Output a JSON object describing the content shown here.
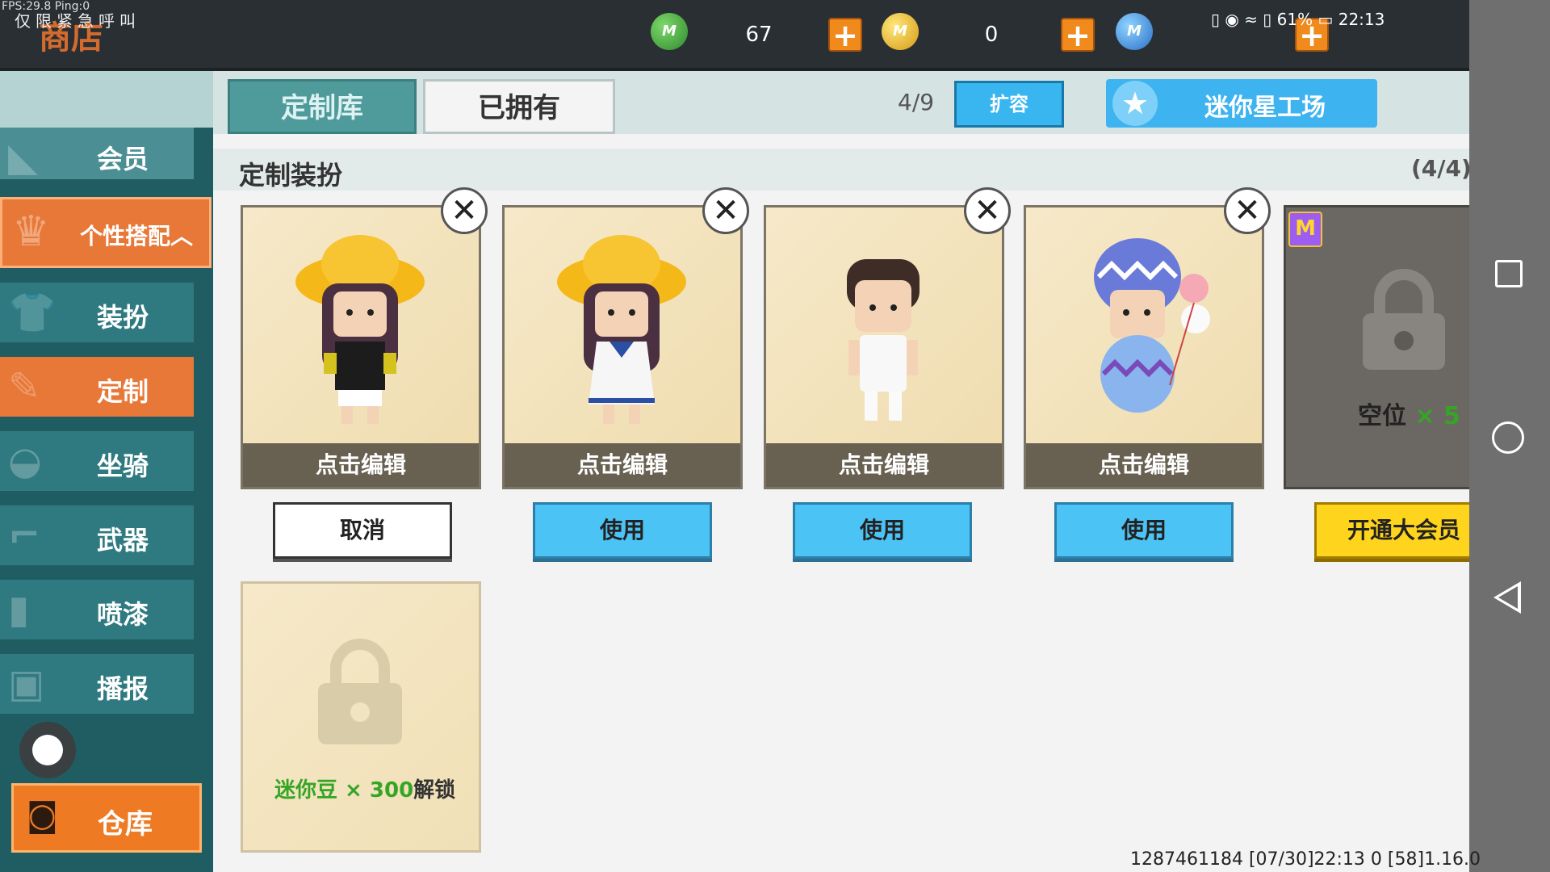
{
  "top": {
    "fps": "FPS:29.8  Ping:0",
    "status_strip": "仅限紧急呼叫",
    "shop_title": "商店",
    "currency_green": "67",
    "currency_gold": "0",
    "coin_letter": "M",
    "plus": "+",
    "system_status": "▯ ◉ ≈ ▯ 61%  ▭ 22:13",
    "close": "✕"
  },
  "sidebar": {
    "member": "会员",
    "personal": "个性搭配︿",
    "items": [
      "装扮",
      "定制",
      "坐骑",
      "武器",
      "喷漆",
      "播报"
    ],
    "active_index": 1,
    "warehouse": "仓库"
  },
  "tabs": {
    "custom_lib": "定制库",
    "owned": "已拥有",
    "capacity": "4/9",
    "expand": "扩容",
    "workshop": "迷你星工场"
  },
  "section": {
    "title": "定制装扮",
    "count": "(4/4)"
  },
  "cards": [
    {
      "edit": "点击编辑",
      "action": "取消",
      "remove": "✕"
    },
    {
      "edit": "点击编辑",
      "action": "使用",
      "remove": "✕"
    },
    {
      "edit": "点击编辑",
      "action": "使用",
      "remove": "✕"
    },
    {
      "edit": "点击编辑",
      "action": "使用",
      "remove": "✕"
    }
  ],
  "vip_slot": {
    "badge": "M",
    "slot_label": "空位",
    "slot_mult": "× 5",
    "action": "开通大会员"
  },
  "bean_slot": {
    "green_text": "迷你豆 × 300",
    "suffix": "解锁"
  },
  "footer": "1287461184   [07/30]22:13 0  [58]1.16.0",
  "colors": {
    "accent_orange": "#e87838",
    "teal": "#2f7a80",
    "use_blue": "#4cc3f5",
    "vip_yellow": "#ffd41c"
  }
}
